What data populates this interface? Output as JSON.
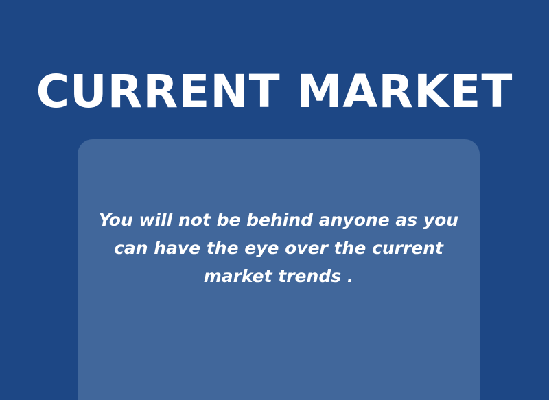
{
  "slide": {
    "title": "CURRENT MARKET",
    "card": {
      "lines": [
        "You will not be behind anyone as you",
        "can have the eye over the current",
        "market trends ."
      ]
    }
  },
  "colors": {
    "background": "#1d4785",
    "card": "#41679b",
    "text": "#ffffff"
  }
}
